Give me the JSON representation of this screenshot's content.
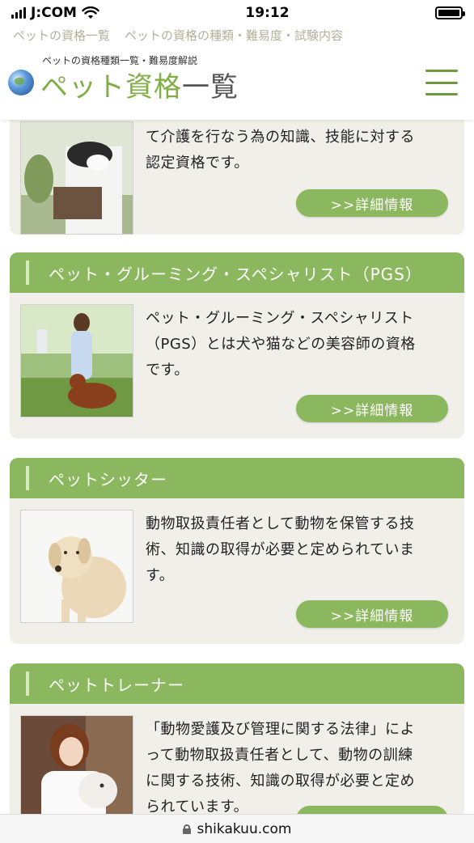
{
  "status_bar": {
    "carrier": "J:COM",
    "time": "19:12"
  },
  "top_links": [
    "ペットの資格一覧",
    "ペットの資格の種類・難易度・試験内容"
  ],
  "header": {
    "tagline": "ペットの資格種類一覧・難易度解説",
    "logo_green": "ペット資格",
    "logo_dark": "一覧"
  },
  "cards": [
    {
      "title": "",
      "desc_lines": [
        "て介護を行なう為の知識、技能に対する",
        "認定資格です。"
      ],
      "button": ">>詳細情報",
      "image": "caregiver-with-dog-photo"
    },
    {
      "title": "ペット・グルーミング・スペシャリスト（PGS）",
      "desc_lines": [
        "ペット・グルーミング・スペシャリスト",
        "（PGS）とは犬や猫などの美容師の資格",
        "です。"
      ],
      "button": ">>詳細情報",
      "image": "woman-with-dog-photo"
    },
    {
      "title": "ペットシッター",
      "desc_lines": [
        "動物取扱責任者として動物を保管する技",
        "術、知識の取得が必要と定められていま",
        "す。"
      ],
      "button": ">>詳細情報",
      "image": "labrador-photo"
    },
    {
      "title": "ペットトレーナー",
      "desc_lines": [
        "「動物愛護及び管理に関する法律」によ",
        "って動物取扱責任者として、動物の訓練",
        "に関する技術、知識の取得が必要と定め",
        "られています。"
      ],
      "button": "",
      "image": "woman-holding-dog-photo"
    }
  ],
  "url_bar": {
    "domain": "shikakuu.com"
  },
  "colors": {
    "accent_green": "#8bb85e",
    "logo_green": "#7fae45",
    "card_bg": "#f1efe9"
  }
}
